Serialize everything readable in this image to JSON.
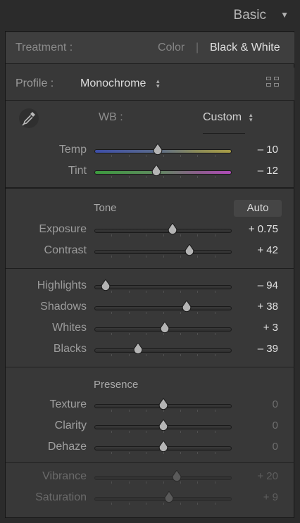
{
  "panel": {
    "title": "Basic"
  },
  "treatment": {
    "label": "Treatment :",
    "options": [
      "Color",
      "Black & White"
    ],
    "separator": "|",
    "selected": "Black & White"
  },
  "profile": {
    "label": "Profile :",
    "value": "Monochrome",
    "browse_icon": "grid-icon"
  },
  "wb": {
    "label": "WB :",
    "value": "Custom",
    "picker_icon": "eyedropper-icon"
  },
  "sections": {
    "tone": "Tone",
    "auto": "Auto",
    "presence": "Presence"
  },
  "sliders": {
    "temp": {
      "label": "Temp",
      "value": "– 10",
      "position": 0.46
    },
    "tint": {
      "label": "Tint",
      "value": "– 12",
      "position": 0.45
    },
    "exposure": {
      "label": "Exposure",
      "value": "+ 0.75",
      "position": 0.57
    },
    "contrast": {
      "label": "Contrast",
      "value": "+ 42",
      "position": 0.69
    },
    "highlights": {
      "label": "Highlights",
      "value": "– 94",
      "position": 0.08
    },
    "shadows": {
      "label": "Shadows",
      "value": "+ 38",
      "position": 0.67
    },
    "whites": {
      "label": "Whites",
      "value": "+ 3",
      "position": 0.515
    },
    "blacks": {
      "label": "Blacks",
      "value": "– 39",
      "position": 0.32
    },
    "texture": {
      "label": "Texture",
      "value": "0",
      "position": 0.5
    },
    "clarity": {
      "label": "Clarity",
      "value": "0",
      "position": 0.5
    },
    "dehaze": {
      "label": "Dehaze",
      "value": "0",
      "position": 0.5
    },
    "vibrance": {
      "label": "Vibrance",
      "value": "+ 20",
      "position": 0.6
    },
    "saturation": {
      "label": "Saturation",
      "value": "+ 9",
      "position": 0.545
    }
  },
  "colors": {
    "panel_bg": "#383838",
    "text_active": "#e0e0e0",
    "text_muted": "#8a8a8a",
    "text_disabled": "#6a6a6a",
    "thumb": "#b4b4b4"
  }
}
